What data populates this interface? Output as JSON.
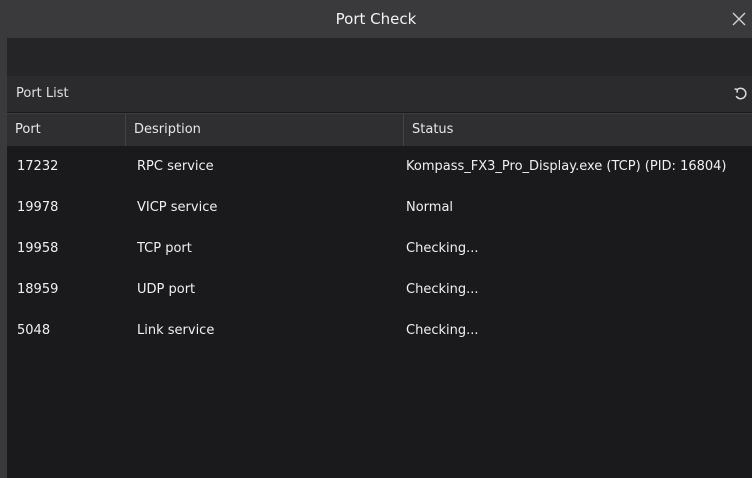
{
  "window": {
    "title": "Port Check",
    "close_icon": "close-icon"
  },
  "section": {
    "title": "Port List",
    "refresh_icon": "refresh-icon"
  },
  "table": {
    "columns": [
      "Port",
      "Desription",
      "Status"
    ],
    "rows": [
      {
        "port": "17232",
        "description": "RPC service",
        "status": "Kompass_FX3_Pro_Display.exe (TCP) (PID: 16804)"
      },
      {
        "port": "19978",
        "description": "VICP service",
        "status": "Normal"
      },
      {
        "port": "19958",
        "description": "TCP port",
        "status": "Checking..."
      },
      {
        "port": "18959",
        "description": "UDP port",
        "status": "Checking..."
      },
      {
        "port": "5048",
        "description": "Link service",
        "status": "Checking..."
      }
    ]
  }
}
